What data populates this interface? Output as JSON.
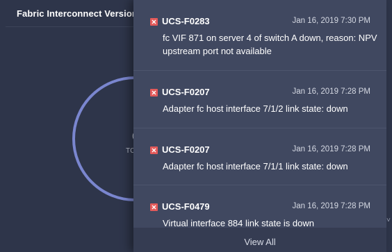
{
  "card": {
    "title": "Fabric Interconnect Version",
    "peek_top": "(",
    "peek_sub": "TC"
  },
  "popover": {
    "severity_color": "#e35a5a",
    "alarms": [
      {
        "code": "UCS-F0283",
        "time": "Jan 16, 2019 7:30 PM",
        "message": "fc VIF 871 on server 4 of switch A down, reason: NPV upstream port not available",
        "severity_icon": "critical-icon"
      },
      {
        "code": "UCS-F0207",
        "time": "Jan 16, 2019 7:28 PM",
        "message": "Adapter fc host interface 7/1/2 link state: down",
        "severity_icon": "critical-icon"
      },
      {
        "code": "UCS-F0207",
        "time": "Jan 16, 2019 7:28 PM",
        "message": "Adapter fc host interface 7/1/1 link state: down",
        "severity_icon": "critical-icon"
      },
      {
        "code": "UCS-F0479",
        "time": "Jan 16, 2019 7:28 PM",
        "message": "Virtual interface 884 link state is down",
        "severity_icon": "critical-icon"
      }
    ],
    "view_all_label": "View All"
  }
}
